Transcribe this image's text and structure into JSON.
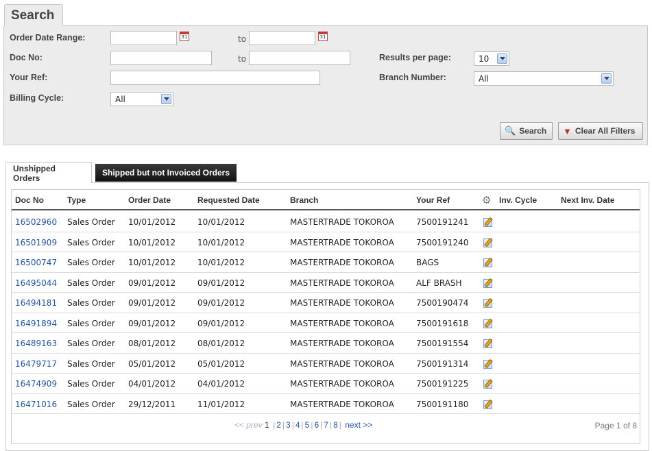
{
  "search": {
    "title": "Search",
    "order_date_label": "Order Date Range:",
    "doc_no_label": "Doc No:",
    "your_ref_label": "Your Ref:",
    "billing_cycle_label": "Billing Cycle:",
    "to_label": "to",
    "results_per_page_label": "Results per page:",
    "branch_number_label": "Branch Number:",
    "results_per_page_value": "10",
    "branch_number_value": "All",
    "billing_cycle_value": "All",
    "calendar_glyph": "31",
    "search_button": "Search",
    "clear_button": "Clear All Filters"
  },
  "tabs": {
    "unshipped": "Unshipped Orders",
    "shipped": "Shipped but not Invoiced Orders"
  },
  "table": {
    "headers": {
      "doc_no": "Doc No",
      "type": "Type",
      "order_date": "Order Date",
      "requested_date": "Requested Date",
      "branch": "Branch",
      "your_ref": "Your Ref",
      "inv_cycle": "Inv. Cycle",
      "next_inv_date": "Next Inv. Date"
    },
    "rows": [
      {
        "doc_no": "16502960",
        "type": "Sales Order",
        "order_date": "10/01/2012",
        "requested_date": "10/01/2012",
        "branch": "MASTERTRADE TOKOROA",
        "your_ref": "7500191241"
      },
      {
        "doc_no": "16501909",
        "type": "Sales Order",
        "order_date": "10/01/2012",
        "requested_date": "10/01/2012",
        "branch": "MASTERTRADE TOKOROA",
        "your_ref": "7500191240"
      },
      {
        "doc_no": "16500747",
        "type": "Sales Order",
        "order_date": "10/01/2012",
        "requested_date": "10/01/2012",
        "branch": "MASTERTRADE TOKOROA",
        "your_ref": "BAGS"
      },
      {
        "doc_no": "16495044",
        "type": "Sales Order",
        "order_date": "09/01/2012",
        "requested_date": "09/01/2012",
        "branch": "MASTERTRADE TOKOROA",
        "your_ref": "ALF BRASH"
      },
      {
        "doc_no": "16494181",
        "type": "Sales Order",
        "order_date": "09/01/2012",
        "requested_date": "09/01/2012",
        "branch": "MASTERTRADE TOKOROA",
        "your_ref": "7500190474"
      },
      {
        "doc_no": "16491894",
        "type": "Sales Order",
        "order_date": "09/01/2012",
        "requested_date": "09/01/2012",
        "branch": "MASTERTRADE TOKOROA",
        "your_ref": "7500191618"
      },
      {
        "doc_no": "16489163",
        "type": "Sales Order",
        "order_date": "08/01/2012",
        "requested_date": "08/01/2012",
        "branch": "MASTERTRADE TOKOROA",
        "your_ref": "7500191554"
      },
      {
        "doc_no": "16479717",
        "type": "Sales Order",
        "order_date": "05/01/2012",
        "requested_date": "05/01/2012",
        "branch": "MASTERTRADE TOKOROA",
        "your_ref": "7500191314"
      },
      {
        "doc_no": "16474909",
        "type": "Sales Order",
        "order_date": "04/01/2012",
        "requested_date": "04/01/2012",
        "branch": "MASTERTRADE TOKOROA",
        "your_ref": "7500191225"
      },
      {
        "doc_no": "16471016",
        "type": "Sales Order",
        "order_date": "29/12/2011",
        "requested_date": "11/01/2012",
        "branch": "MASTERTRADE TOKOROA",
        "your_ref": "7500191180"
      }
    ]
  },
  "pagination": {
    "prev": "<< prev",
    "current": "1",
    "pages": [
      "2",
      "3",
      "4",
      "5",
      "6",
      "7",
      "8"
    ],
    "next": "next >>",
    "info": "Page 1 of 8"
  }
}
